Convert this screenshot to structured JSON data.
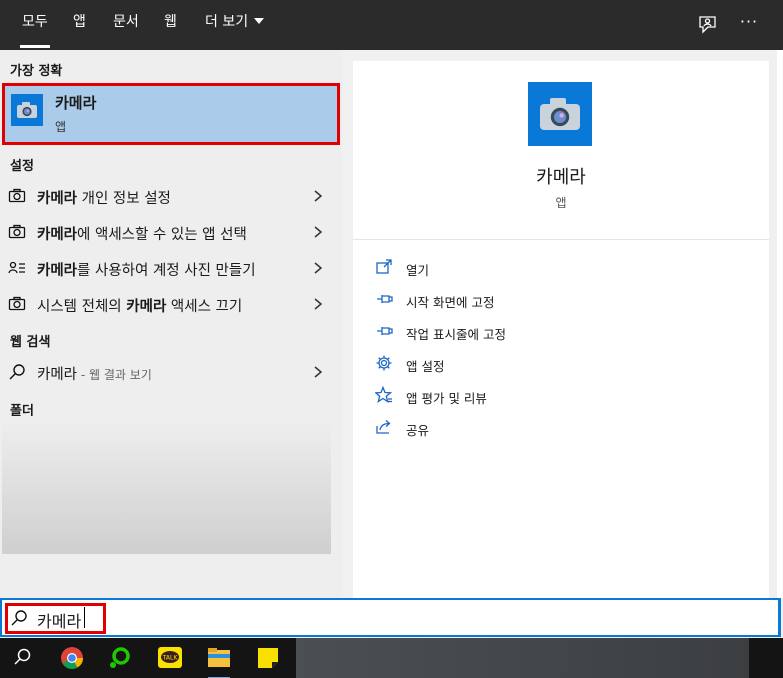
{
  "tabs": [
    {
      "label": "모두",
      "active": true
    },
    {
      "label": "앱",
      "active": false
    },
    {
      "label": "문서",
      "active": false
    },
    {
      "label": "웹",
      "active": false
    },
    {
      "label": "더 보기",
      "active": false
    }
  ],
  "top_icons": [
    "feedback-icon",
    "more-options-icon"
  ],
  "more_options_label": "···",
  "left": {
    "best_match_header": "가장 정확",
    "best_match": {
      "title": "카메라",
      "subtitle": "앱",
      "icon": "camera-icon"
    },
    "settings_header": "설정",
    "settings": [
      {
        "bold": "카메라",
        "rest": " 개인 정보 설정",
        "icon": "camera-settings-icon"
      },
      {
        "bold": "카메라",
        "rest": "에 액세스할 수 있는 앱 선택",
        "icon": "camera-settings-icon"
      },
      {
        "bold": "카메라",
        "rest": "를 사용하여 계정 사진 만들기",
        "icon": "account-icon"
      },
      {
        "prefix": "시스템 전체의 ",
        "bold": "카메라",
        "rest": " 액세스 끄기",
        "icon": "camera-settings-icon"
      }
    ],
    "web_header": "웹 검색",
    "web": {
      "text": "카메라",
      "sub": " - 웹 결과 보기",
      "icon": "search-icon"
    },
    "folder_header": "폴더"
  },
  "detail": {
    "title": "카메라",
    "subtitle": "앱",
    "actions": [
      {
        "label": "열기",
        "icon": "open-icon"
      },
      {
        "label": "시작 화면에 고정",
        "icon": "pin-icon"
      },
      {
        "label": "작업 표시줄에 고정",
        "icon": "pin-icon"
      },
      {
        "label": "앱 설정",
        "icon": "gear-icon"
      },
      {
        "label": "앱 평가 및 리뷰",
        "icon": "star-icon"
      },
      {
        "label": "공유",
        "icon": "share-icon"
      }
    ]
  },
  "search": {
    "value": "카메라"
  },
  "taskbar": [
    "search-icon",
    "chrome-icon",
    "line-icon",
    "kakaotalk-icon",
    "file-explorer-icon",
    "sticky-notes-icon"
  ],
  "kakao_label": "TALK",
  "colors": {
    "accent": "#0a78d7",
    "highlight": "#aaccea",
    "annotation_red": "#e00000",
    "topbar": "#2b2b2b"
  }
}
